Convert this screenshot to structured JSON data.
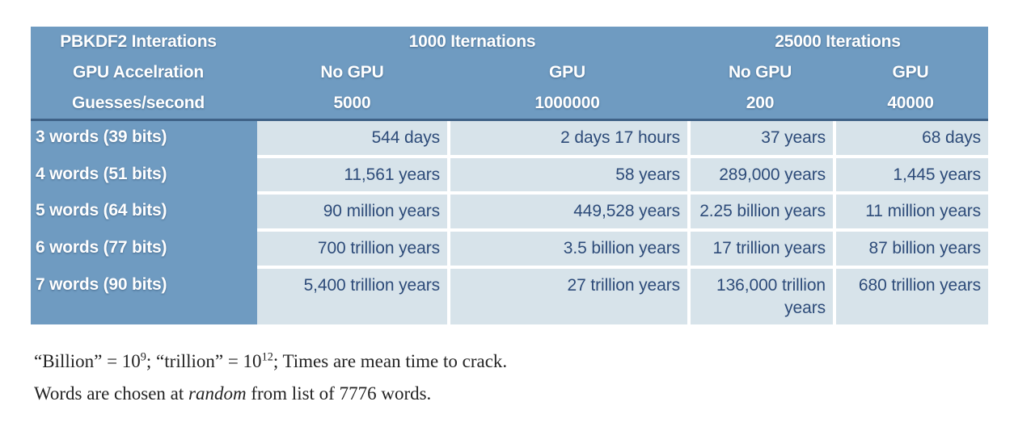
{
  "table": {
    "header_rows": [
      {
        "label": "PBKDF2 Interations",
        "groups": [
          "1000 Iternations",
          "25000 Iterations"
        ]
      },
      {
        "label": "GPU Accelration",
        "values": [
          "No GPU",
          "GPU",
          "No GPU",
          "GPU"
        ]
      },
      {
        "label": "Guesses/second",
        "values": [
          "5000",
          "1000000",
          "200",
          "40000"
        ]
      }
    ],
    "rows": [
      {
        "label": "3 words (39 bits)",
        "values": [
          "544 days",
          "2 days 17 hours",
          "37 years",
          "68 days"
        ]
      },
      {
        "label": "4 words (51 bits)",
        "values": [
          "11,561 years",
          "58 years",
          "289,000 years",
          "1,445 years"
        ]
      },
      {
        "label": "5 words (64 bits)",
        "values": [
          "90 million years",
          "449,528 years",
          "2.25 billion years",
          "11 million years"
        ]
      },
      {
        "label": "6 words (77 bits)",
        "values": [
          "700 trillion years",
          "3.5 billion years",
          "17 trillion years",
          "87 billion years"
        ]
      },
      {
        "label": "7 words (90 bits)",
        "values": [
          "5,400 trillion years",
          "27 trillion years",
          "136,000 trillion years",
          "680 trillion years"
        ]
      }
    ]
  },
  "footnotes": {
    "line1_part1": "“Billion” = 10",
    "line1_sup1": "9",
    "line1_part2": "; “trillion” = 10",
    "line1_sup2": "12",
    "line1_part3": "; Times are mean time to crack.",
    "line2_part1": "Words are chosen at ",
    "line2_italic": "random",
    "line2_part2": " from list of 7776 words."
  },
  "colors": {
    "header_blue": "#6f9bc1",
    "cell_blue": "#d7e3ea",
    "cell_text": "#2d4b79",
    "header_rule": "#3f6287"
  }
}
